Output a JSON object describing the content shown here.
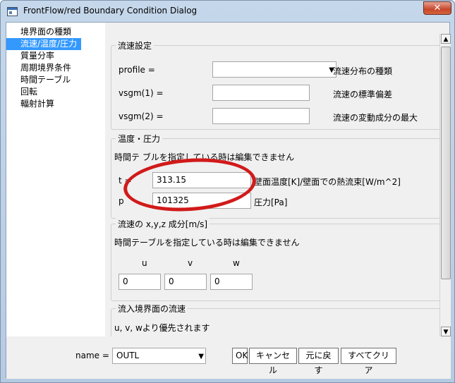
{
  "window": {
    "title": "FrontFlow/red Boundary Condition Dialog",
    "close_label": "✕"
  },
  "nav": {
    "items": [
      {
        "label": "境界面の種類"
      },
      {
        "label": "流速/温度/圧力",
        "selected": true
      },
      {
        "label": "質量分率"
      },
      {
        "label": "周期境界条件"
      },
      {
        "label": "時間テーブル"
      },
      {
        "label": "回転"
      },
      {
        "label": "輻射計算"
      }
    ]
  },
  "velocity": {
    "title": "流速設定",
    "profile_label": "profile =",
    "profile_value": "",
    "profile_desc": "流速分布の種類",
    "vsgm1_label": "vsgm(1) =",
    "vsgm1_value": "",
    "vsgm1_desc": "流速の標準偏差",
    "vsgm2_label": "vsgm(2) =",
    "vsgm2_value": "",
    "vsgm2_desc": "流速の変動成分の最大"
  },
  "temperature": {
    "title": "温度・圧力",
    "note": "時間テ ブルを指定している時は編集できません",
    "t_label": "t =",
    "t_value": "313.15",
    "t_desc": "壁面温度[K]/壁面での熱流束[W/m^2]",
    "p_label": "p",
    "p_value": "101325",
    "p_desc": "圧力[Pa]"
  },
  "components": {
    "title": "流速の x,y,z 成分[m/s]",
    "note": "時間テーブルを指定している時は編集できません",
    "u_label": "u",
    "v_label": "v",
    "w_label": "w",
    "u_value": "0",
    "v_value": "0",
    "w_value": "0"
  },
  "inflow": {
    "title": "流入境界面の流速",
    "note": "u, v, wより優先されます"
  },
  "footer": {
    "name_label": "name =",
    "name_value": "OUTL",
    "ok_label": "OK",
    "cancel_label": "キャンセル",
    "revert_label": "元に戻す",
    "clear_label": "すべてクリア"
  },
  "colors": {
    "accent": "#3399ff",
    "highlight": "#d11a1a"
  }
}
